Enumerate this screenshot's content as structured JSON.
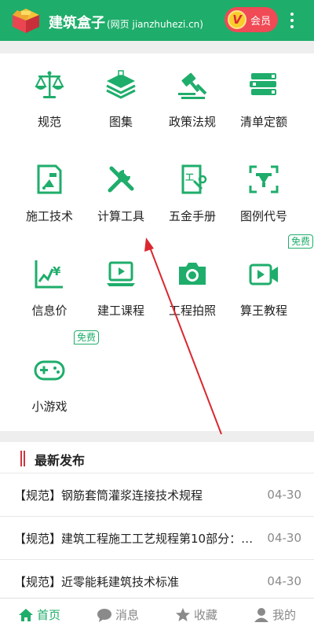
{
  "header": {
    "app_name": "建筑盒子",
    "site_note": "(网页 jianzhuhezi.cn)",
    "vip_badge": "V",
    "vip_label": "会员",
    "more_icon": "more-vertical-icon"
  },
  "grid": [
    {
      "label": "规范",
      "icon": "scale-icon"
    },
    {
      "label": "图集",
      "icon": "layers-icon"
    },
    {
      "label": "政策法规",
      "icon": "gavel-icon"
    },
    {
      "label": "清单定额",
      "icon": "books-icon"
    },
    {
      "label": "施工技术",
      "icon": "construction-doc-icon"
    },
    {
      "label": "计算工具",
      "icon": "tools-icon"
    },
    {
      "label": "五金手册",
      "icon": "hardware-manual-icon"
    },
    {
      "label": "图例代号",
      "icon": "legend-icon"
    },
    {
      "label": "信息价",
      "icon": "price-chart-icon"
    },
    {
      "label": "建工课程",
      "icon": "course-laptop-icon"
    },
    {
      "label": "工程拍照",
      "icon": "camera-icon"
    },
    {
      "label": "算王教程",
      "icon": "video-icon",
      "badge": "免费"
    },
    {
      "label": "小游戏",
      "icon": "gamepad-icon",
      "badge": "免费"
    }
  ],
  "latest": {
    "title": "最新发布",
    "items": [
      {
        "text": "【规范】钢筋套筒灌浆连接技术规程",
        "date": "04-30"
      },
      {
        "text": "【规范】建筑工程施工工艺规程第10部分：…",
        "date": "04-30"
      },
      {
        "text": "【规范】近零能耗建筑技术标准",
        "date": "04-30"
      }
    ]
  },
  "tabbar": [
    {
      "label": "首页",
      "icon": "home-icon",
      "active": true
    },
    {
      "label": "消息",
      "icon": "message-icon"
    },
    {
      "label": "收藏",
      "icon": "star-icon"
    },
    {
      "label": "我的",
      "icon": "user-icon"
    }
  ],
  "colors": {
    "brand": "#1fad6b",
    "vip": "#ef4a55",
    "annotation": "#d9282f"
  }
}
